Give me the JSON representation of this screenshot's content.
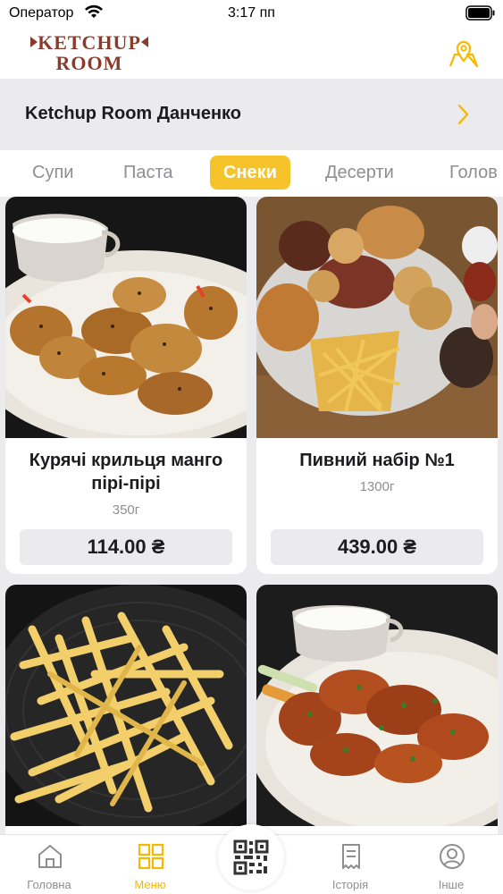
{
  "status_bar": {
    "carrier": "Оператор",
    "time": "3:17 пп"
  },
  "header": {
    "logo_text_line1": "KETCHUP",
    "logo_text_line2": "ROOM",
    "location_icon": "map-pin-icon"
  },
  "restaurant": {
    "name": "Ketchup Room Данченко",
    "chevron_icon": "chevron-right-icon"
  },
  "categories": [
    {
      "label": "Супи",
      "active": false
    },
    {
      "label": "Паста",
      "active": false
    },
    {
      "label": "Снеки",
      "active": true
    },
    {
      "label": "Десерти",
      "active": false
    },
    {
      "label": "Голов",
      "active": false
    }
  ],
  "products": [
    {
      "name": "Курячі крильця манго пірі-пірі",
      "weight": "350г",
      "price": "114.00 ₴"
    },
    {
      "name": "Пивний набір №1",
      "weight": "1300г",
      "price": "439.00 ₴"
    },
    {
      "name": "",
      "weight": "",
      "price": ""
    },
    {
      "name": "",
      "weight": "",
      "price": ""
    }
  ],
  "tabbar": {
    "items": [
      {
        "label": "Головна",
        "icon": "home-icon"
      },
      {
        "label": "Меню",
        "icon": "menu-grid-icon"
      },
      {
        "label": "Історія",
        "icon": "receipt-icon"
      },
      {
        "label": "Інше",
        "icon": "profile-icon"
      }
    ],
    "center_icon": "qr-code-icon"
  },
  "colors": {
    "accent": "#f6c32a",
    "background": "#ebebed",
    "text": "#1c1c1e",
    "muted": "#8e8e93"
  }
}
